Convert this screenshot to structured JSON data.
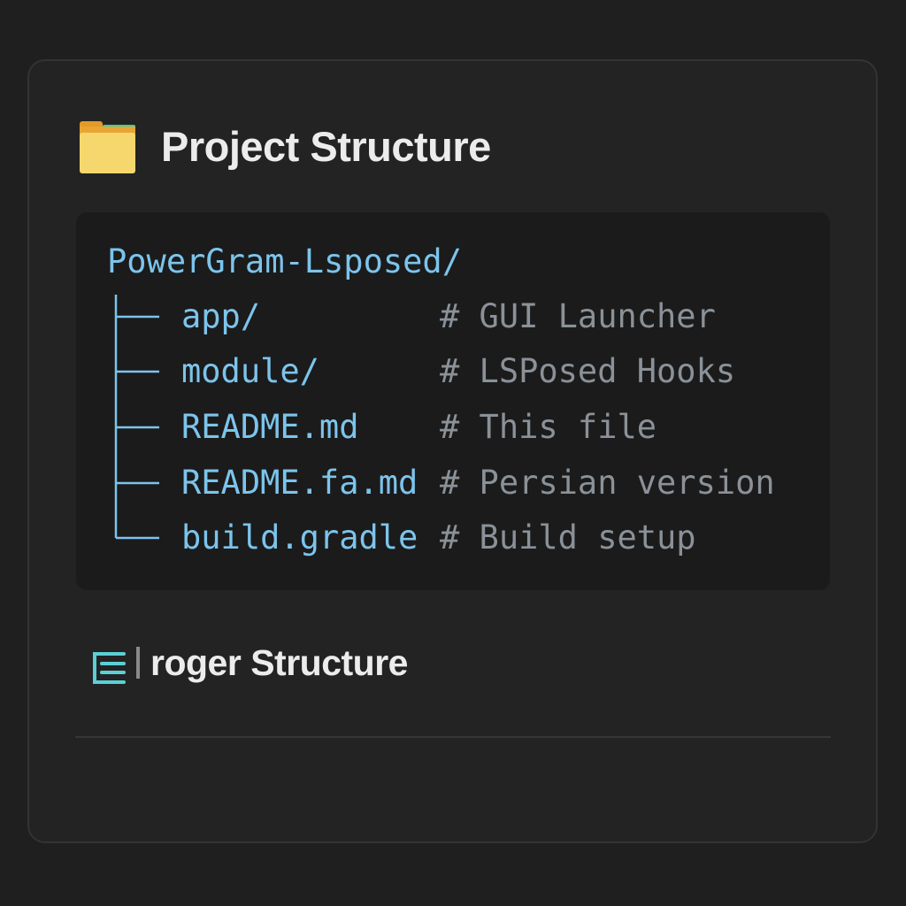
{
  "header": {
    "title": "Project Structure",
    "icon": "folder-icon"
  },
  "tree": {
    "root": "PowerGram-Lsposed/",
    "items": [
      {
        "name": "app/",
        "comment": "# GUI Launcher"
      },
      {
        "name": "module/",
        "comment": "# LSPosed Hooks"
      },
      {
        "name": "README.md",
        "comment": "# This file"
      },
      {
        "name": "README.fa.md",
        "comment": "# Persian version"
      },
      {
        "name": "build.gradle",
        "comment": "# Build setup"
      }
    ]
  },
  "section": {
    "title": "roger Structure",
    "icon": "list-icon"
  },
  "colors": {
    "accent": "#7cc4ec",
    "comment": "#8a9198",
    "icon_teal": "#5ccfd6"
  }
}
